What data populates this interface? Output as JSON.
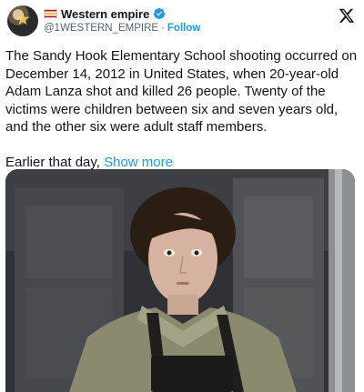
{
  "author": {
    "display_name": "Western empire",
    "handle": "@1WESTERN_EMPIRE",
    "separator": "·",
    "follow_label": "Follow",
    "verified_icon": "verified-badge-icon",
    "brand_color": "#1d9bf0"
  },
  "tweet": {
    "paragraph_1": "The Sandy Hook Elementary School shooting occurred on December 14, 2012 in United States, when 20-year-old Adam Lanza shot and killed 26 people. Twenty of the victims were children between six and seven years old, and the other six were adult staff members.",
    "paragraph_2_prefix": "Earlier that day, ",
    "show_more_label": "Show more"
  },
  "media": {
    "type": "photo"
  }
}
